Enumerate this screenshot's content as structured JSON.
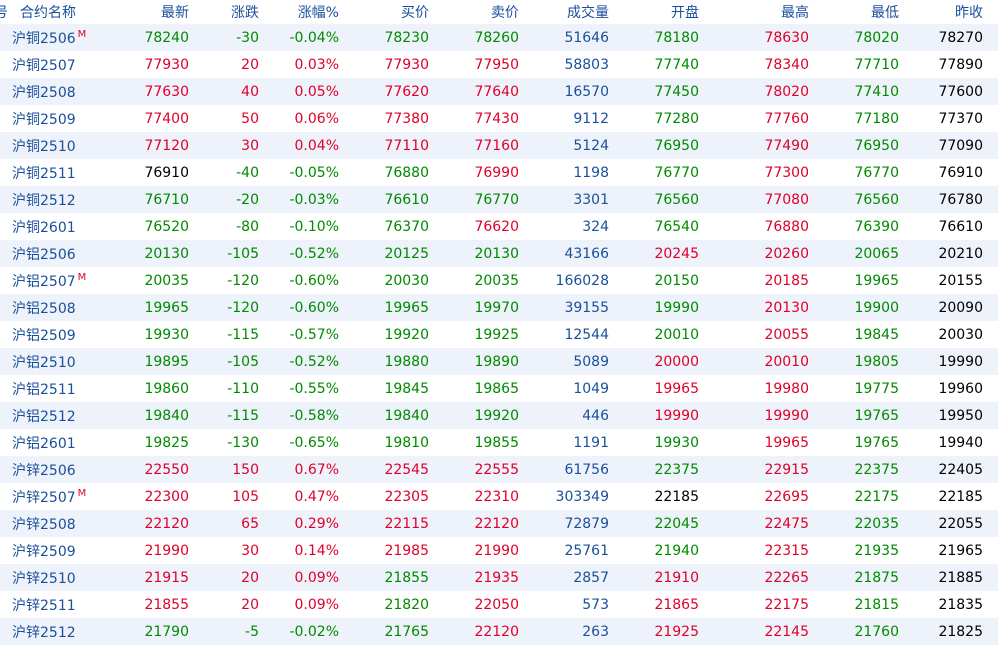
{
  "columns": {
    "row_no_stub": "号",
    "contract": "合约名称",
    "last": "最新",
    "change": "涨跌",
    "change_pct": "涨幅%",
    "bid": "买价",
    "ask": "卖价",
    "volume": "成交量",
    "open": "开盘",
    "high": "最高",
    "low": "最低",
    "prev_close": "昨收"
  },
  "colors": {
    "up": "#e0002a",
    "down": "#008a00",
    "flat": "#000000",
    "label": "#1a4f9c",
    "row_alt": "#eef3fb"
  },
  "rows": [
    {
      "name": "沪铜2506",
      "main": "M",
      "last": "78240",
      "change": "-30",
      "pct": "-0.04%",
      "bid": "78230",
      "ask": "78260",
      "vol": "51646",
      "open": "78180",
      "high": "78630",
      "low": "78020",
      "prev": "78270"
    },
    {
      "name": "沪铜2507",
      "main": "",
      "last": "77930",
      "change": "20",
      "pct": "0.03%",
      "bid": "77930",
      "ask": "77950",
      "vol": "58803",
      "open": "77740",
      "high": "78340",
      "low": "77710",
      "prev": "77890"
    },
    {
      "name": "沪铜2508",
      "main": "",
      "last": "77630",
      "change": "40",
      "pct": "0.05%",
      "bid": "77620",
      "ask": "77640",
      "vol": "16570",
      "open": "77450",
      "high": "78020",
      "low": "77410",
      "prev": "77600"
    },
    {
      "name": "沪铜2509",
      "main": "",
      "last": "77400",
      "change": "50",
      "pct": "0.06%",
      "bid": "77380",
      "ask": "77430",
      "vol": "9112",
      "open": "77280",
      "high": "77760",
      "low": "77180",
      "prev": "77370"
    },
    {
      "name": "沪铜2510",
      "main": "",
      "last": "77120",
      "change": "30",
      "pct": "0.04%",
      "bid": "77110",
      "ask": "77160",
      "vol": "5124",
      "open": "76950",
      "high": "77490",
      "low": "76950",
      "prev": "77090"
    },
    {
      "name": "沪铜2511",
      "main": "",
      "last": "76910",
      "change": "-40",
      "pct": "-0.05%",
      "bid": "76880",
      "ask": "76990",
      "vol": "1198",
      "open": "76770",
      "high": "77300",
      "low": "76770",
      "prev": "76910"
    },
    {
      "name": "沪铜2512",
      "main": "",
      "last": "76710",
      "change": "-20",
      "pct": "-0.03%",
      "bid": "76610",
      "ask": "76770",
      "vol": "3301",
      "open": "76560",
      "high": "77080",
      "low": "76560",
      "prev": "76780"
    },
    {
      "name": "沪铜2601",
      "main": "",
      "last": "76520",
      "change": "-80",
      "pct": "-0.10%",
      "bid": "76370",
      "ask": "76620",
      "vol": "324",
      "open": "76540",
      "high": "76880",
      "low": "76390",
      "prev": "76610"
    },
    {
      "name": "沪铝2506",
      "main": "",
      "last": "20130",
      "change": "-105",
      "pct": "-0.52%",
      "bid": "20125",
      "ask": "20130",
      "vol": "43166",
      "open": "20245",
      "high": "20260",
      "low": "20065",
      "prev": "20210"
    },
    {
      "name": "沪铝2507",
      "main": "M",
      "last": "20035",
      "change": "-120",
      "pct": "-0.60%",
      "bid": "20030",
      "ask": "20035",
      "vol": "166028",
      "open": "20150",
      "high": "20185",
      "low": "19965",
      "prev": "20155"
    },
    {
      "name": "沪铝2508",
      "main": "",
      "last": "19965",
      "change": "-120",
      "pct": "-0.60%",
      "bid": "19965",
      "ask": "19970",
      "vol": "39155",
      "open": "19990",
      "high": "20130",
      "low": "19900",
      "prev": "20090"
    },
    {
      "name": "沪铝2509",
      "main": "",
      "last": "19930",
      "change": "-115",
      "pct": "-0.57%",
      "bid": "19920",
      "ask": "19925",
      "vol": "12544",
      "open": "20010",
      "high": "20055",
      "low": "19845",
      "prev": "20030"
    },
    {
      "name": "沪铝2510",
      "main": "",
      "last": "19895",
      "change": "-105",
      "pct": "-0.52%",
      "bid": "19880",
      "ask": "19890",
      "vol": "5089",
      "open": "20000",
      "high": "20010",
      "low": "19805",
      "prev": "19990"
    },
    {
      "name": "沪铝2511",
      "main": "",
      "last": "19860",
      "change": "-110",
      "pct": "-0.55%",
      "bid": "19845",
      "ask": "19865",
      "vol": "1049",
      "open": "19965",
      "high": "19980",
      "low": "19775",
      "prev": "19960"
    },
    {
      "name": "沪铝2512",
      "main": "",
      "last": "19840",
      "change": "-115",
      "pct": "-0.58%",
      "bid": "19840",
      "ask": "19920",
      "vol": "446",
      "open": "19990",
      "high": "19990",
      "low": "19765",
      "prev": "19950"
    },
    {
      "name": "沪铝2601",
      "main": "",
      "last": "19825",
      "change": "-130",
      "pct": "-0.65%",
      "bid": "19810",
      "ask": "19855",
      "vol": "1191",
      "open": "19930",
      "high": "19965",
      "low": "19765",
      "prev": "19940"
    },
    {
      "name": "沪锌2506",
      "main": "",
      "last": "22550",
      "change": "150",
      "pct": "0.67%",
      "bid": "22545",
      "ask": "22555",
      "vol": "61756",
      "open": "22375",
      "high": "22915",
      "low": "22375",
      "prev": "22405"
    },
    {
      "name": "沪锌2507",
      "main": "M",
      "last": "22300",
      "change": "105",
      "pct": "0.47%",
      "bid": "22305",
      "ask": "22310",
      "vol": "303349",
      "open": "22185",
      "high": "22695",
      "low": "22175",
      "prev": "22185"
    },
    {
      "name": "沪锌2508",
      "main": "",
      "last": "22120",
      "change": "65",
      "pct": "0.29%",
      "bid": "22115",
      "ask": "22120",
      "vol": "72879",
      "open": "22045",
      "high": "22475",
      "low": "22035",
      "prev": "22055"
    },
    {
      "name": "沪锌2509",
      "main": "",
      "last": "21990",
      "change": "30",
      "pct": "0.14%",
      "bid": "21985",
      "ask": "21990",
      "vol": "25761",
      "open": "21940",
      "high": "22315",
      "low": "21935",
      "prev": "21965"
    },
    {
      "name": "沪锌2510",
      "main": "",
      "last": "21915",
      "change": "20",
      "pct": "0.09%",
      "bid": "21855",
      "ask": "21935",
      "vol": "2857",
      "open": "21910",
      "high": "22265",
      "low": "21875",
      "prev": "21885"
    },
    {
      "name": "沪锌2511",
      "main": "",
      "last": "21855",
      "change": "20",
      "pct": "0.09%",
      "bid": "21820",
      "ask": "22050",
      "vol": "573",
      "open": "21865",
      "high": "22175",
      "low": "21815",
      "prev": "21835"
    },
    {
      "name": "沪锌2512",
      "main": "",
      "last": "21790",
      "change": "-5",
      "pct": "-0.02%",
      "bid": "21765",
      "ask": "22120",
      "vol": "263",
      "open": "21925",
      "high": "22145",
      "low": "21760",
      "prev": "21825"
    }
  ]
}
